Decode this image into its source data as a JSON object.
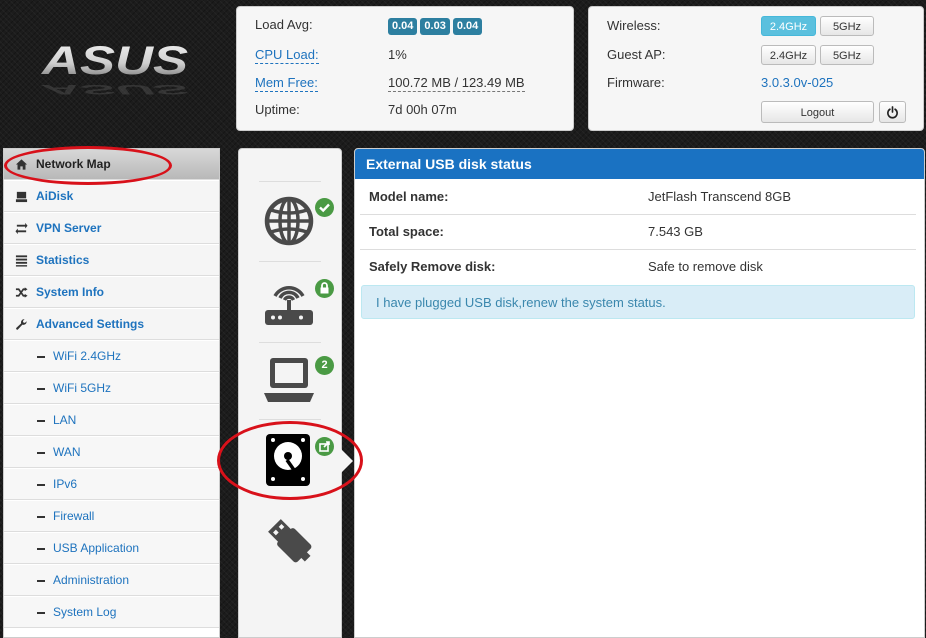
{
  "brand": "ASUS",
  "stats": {
    "load_avg_label": "Load Avg:",
    "load_avg_values": [
      "0.04",
      "0.03",
      "0.04"
    ],
    "cpu_label": "CPU Load:",
    "cpu_value": "1%",
    "mem_label": "Mem Free:",
    "mem_value": "100.72 MB / 123.49 MB",
    "uptime_label": "Uptime:",
    "uptime_value": "7d 00h 07m"
  },
  "wifi": {
    "wireless_label": "Wireless:",
    "guest_label": "Guest AP:",
    "firmware_label": "Firmware:",
    "firmware_value": "3.0.3.0v-025",
    "band_24": "2.4GHz",
    "band_5": "5GHz",
    "logout": "Logout",
    "active_band": "2.4GHz"
  },
  "sidebar": {
    "items": [
      {
        "label": "Network Map",
        "icon": "home-icon",
        "active": true
      },
      {
        "label": "AiDisk",
        "icon": "disk-icon"
      },
      {
        "label": "VPN Server",
        "icon": "retweet-icon"
      },
      {
        "label": "Statistics",
        "icon": "list-icon"
      },
      {
        "label": "System Info",
        "icon": "random-icon"
      },
      {
        "label": "Advanced Settings",
        "icon": "wrench-icon"
      },
      {
        "label": "WiFi 2.4GHz",
        "sub": true
      },
      {
        "label": "WiFi 5GHz",
        "sub": true
      },
      {
        "label": "LAN",
        "sub": true
      },
      {
        "label": "WAN",
        "sub": true
      },
      {
        "label": "IPv6",
        "sub": true
      },
      {
        "label": "Firewall",
        "sub": true
      },
      {
        "label": "USB Application",
        "sub": true
      },
      {
        "label": "Administration",
        "sub": true
      },
      {
        "label": "System Log",
        "sub": true
      }
    ]
  },
  "map": {
    "clients_count": "2",
    "icons": [
      "globe-icon",
      "router-icon",
      "laptop-icon",
      "hard-disk-icon",
      "usb-plug-icon"
    ]
  },
  "main": {
    "title": "External USB disk status",
    "rows": [
      {
        "key": "Model name:",
        "value": "JetFlash Transcend 8GB"
      },
      {
        "key": "Total space:",
        "value": "7.543 GB"
      },
      {
        "key": "Safely Remove disk:",
        "value": "Safe to remove disk"
      }
    ],
    "notice": "I have plugged USB disk,renew the system status."
  },
  "colors": {
    "accent": "#1a72c2",
    "badge": "#2d7fa0",
    "ok_green": "#4a9a44",
    "annotation_red": "#d8111a"
  }
}
